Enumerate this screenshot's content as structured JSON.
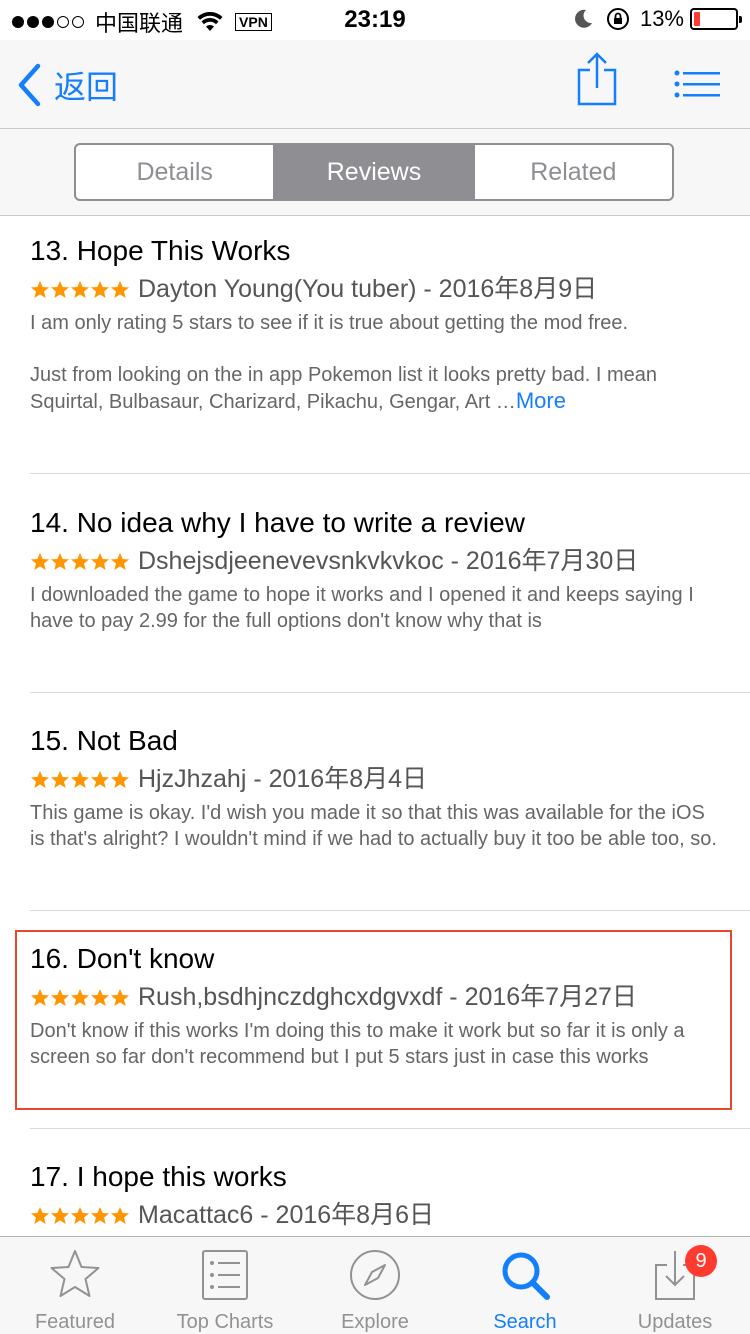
{
  "status_bar": {
    "carrier": "中国联通",
    "vpn": "VPN",
    "time": "23:19",
    "battery": "13%"
  },
  "nav": {
    "back_label": "返回"
  },
  "segmented": {
    "tabs": [
      {
        "label": "Details",
        "active": false
      },
      {
        "label": "Reviews",
        "active": true
      },
      {
        "label": "Related",
        "active": false
      }
    ]
  },
  "reviews": [
    {
      "title": "13. Hope This Works",
      "author_date": "Dayton Young(You tuber) - 2016年8月9日",
      "stars": 5,
      "body": [
        "I am only rating 5 stars to see if it is true about getting the mod free.",
        "Just from looking on the in app Pokemon list it looks pretty bad.  I mean Squirtal, Bulbasaur, Charizard, Pikachu, Gengar, Art …"
      ],
      "more": "More"
    },
    {
      "title": "14. No idea why I have to write a review",
      "author_date": "Dshejsdjeenevevsnkvkvkoc - 2016年7月30日",
      "stars": 5,
      "body": [
        "I downloaded the game to hope it works and I opened it and keeps saying I have to pay 2.99 for the full options don't know why that is"
      ]
    },
    {
      "title": "15. Not Bad",
      "author_date": "HjzJhzahj - 2016年8月4日",
      "stars": 5,
      "body": [
        "This game is okay. I'd wish you made it so that this was available for the iOS is that's alright? I wouldn't mind if we had to actually buy it too be able too, so."
      ]
    },
    {
      "title": "16. Don't know",
      "author_date": "Rush,bsdhjnczdghcxdgvxdf - 2016年7月27日",
      "stars": 5,
      "body": [
        "Don't know if this works I'm doing this to make it work but so far it is only a screen so far don't recommend but I put 5 stars just in case this works"
      ]
    },
    {
      "title": "17. I hope this works",
      "author_date": "Macattac6 - 2016年8月6日",
      "stars": 5,
      "body": []
    }
  ],
  "tab_bar": {
    "items": [
      {
        "label": "Featured",
        "icon": "star-icon"
      },
      {
        "label": "Top Charts",
        "icon": "list-icon"
      },
      {
        "label": "Explore",
        "icon": "compass-icon"
      },
      {
        "label": "Search",
        "icon": "search-icon",
        "active": true
      },
      {
        "label": "Updates",
        "icon": "download-icon",
        "badge": "9"
      }
    ]
  },
  "colors": {
    "accent": "#147efb",
    "star": "#ff9500",
    "highlight": "#e8462e",
    "badge": "#ff3b30"
  }
}
